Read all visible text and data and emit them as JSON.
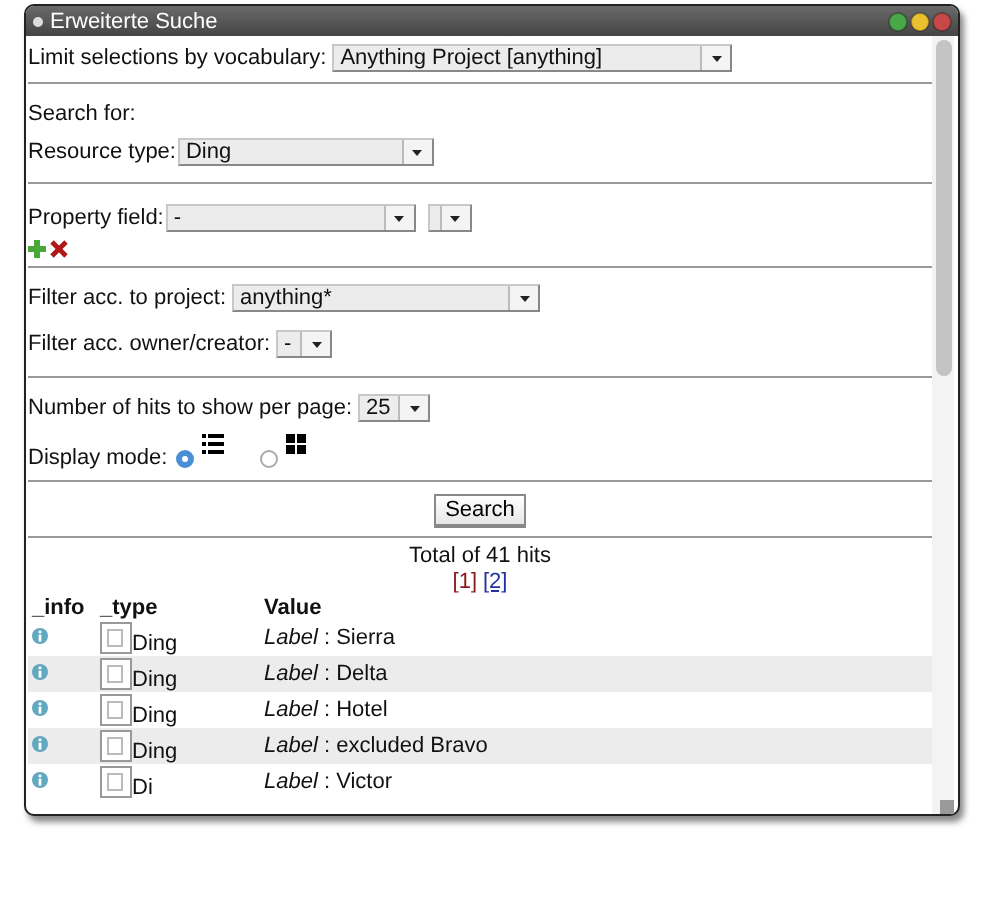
{
  "window": {
    "title": "Erweiterte Suche"
  },
  "vocabulary": {
    "label": "Limit selections by vocabulary:",
    "value": "Anything Project [anything]"
  },
  "search_for": {
    "heading": "Search for:",
    "resource_type": {
      "label": "Resource type:",
      "value": "Ding"
    }
  },
  "property_field": {
    "label": "Property field:",
    "value": "-"
  },
  "project_filter": {
    "label": "Filter acc. to project:",
    "value": "anything*"
  },
  "owner_filter": {
    "label": "Filter acc. owner/creator:",
    "value": "-"
  },
  "hits_per_page": {
    "label": "Number of hits to show per page:",
    "value": "25"
  },
  "display_mode": {
    "label": "Display mode:",
    "options": [
      {
        "kind": "list",
        "selected": true
      },
      {
        "kind": "grid",
        "selected": false
      }
    ]
  },
  "search_button": "Search",
  "results": {
    "total": "Total of 41 hits",
    "pages": [
      {
        "label": "[1]",
        "selected": true
      },
      {
        "label": "[2]",
        "selected": false
      }
    ],
    "columns": [
      "_info",
      "_type",
      "Value"
    ],
    "rows": [
      {
        "type": "Ding",
        "value": "*Label* : Sierra"
      },
      {
        "type": "Ding",
        "value": "*Label* : Delta"
      },
      {
        "type": "Ding",
        "value": "*Label* : Hotel"
      },
      {
        "type": "Ding",
        "value": "*Label* : excluded Bravo"
      },
      {
        "type": "Di",
        "value": "*Label* : Victor"
      }
    ]
  }
}
